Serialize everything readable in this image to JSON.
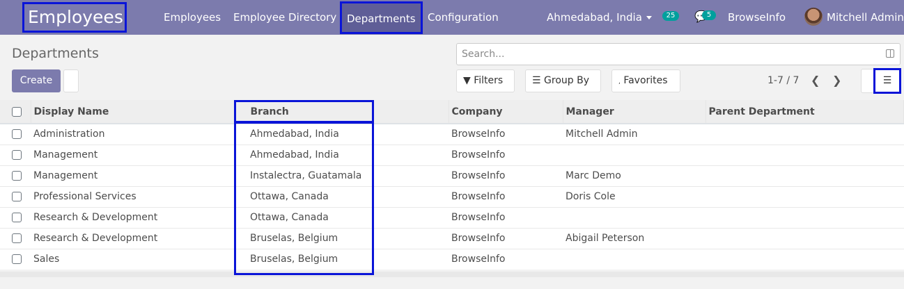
{
  "navbar": {
    "brand": "Employees",
    "menu": [
      "Employees",
      "Employee Directory",
      "Departments",
      "Configuration"
    ],
    "branch": "Ahmedabad, India",
    "activity_count": "25",
    "message_count": "5",
    "company": "BrowseInfo",
    "user": "Mitchell Admin"
  },
  "control": {
    "title": "Departments",
    "create_label": "Create",
    "search_placeholder": "Search...",
    "filters_label": "Filters",
    "groupby_label": "Group By",
    "favorites_label": "Favorites",
    "pager": "1-7 / 7"
  },
  "table": {
    "headers": [
      "Display Name",
      "Branch",
      "Company",
      "Manager",
      "Parent Department"
    ],
    "rows": [
      [
        "Administration",
        "Ahmedabad, India",
        "BrowseInfo",
        "Mitchell Admin",
        ""
      ],
      [
        "Management",
        "Ahmedabad, India",
        "BrowseInfo",
        "",
        ""
      ],
      [
        "Management",
        "Instalectra, Guatamala",
        "BrowseInfo",
        "Marc Demo",
        ""
      ],
      [
        "Professional Services",
        "Ottawa, Canada",
        "BrowseInfo",
        "Doris Cole",
        ""
      ],
      [
        "Research & Development",
        "Ottawa, Canada",
        "BrowseInfo",
        "",
        ""
      ],
      [
        "Research & Development",
        "Bruselas, Belgium",
        "BrowseInfo",
        "Abigail Peterson",
        ""
      ],
      [
        "Sales",
        "Bruselas, Belgium",
        "BrowseInfo",
        "",
        ""
      ]
    ]
  },
  "colors": {
    "navbar": "#7c7bad",
    "highlight": "#0a14d8",
    "badge": "#00a09d"
  }
}
